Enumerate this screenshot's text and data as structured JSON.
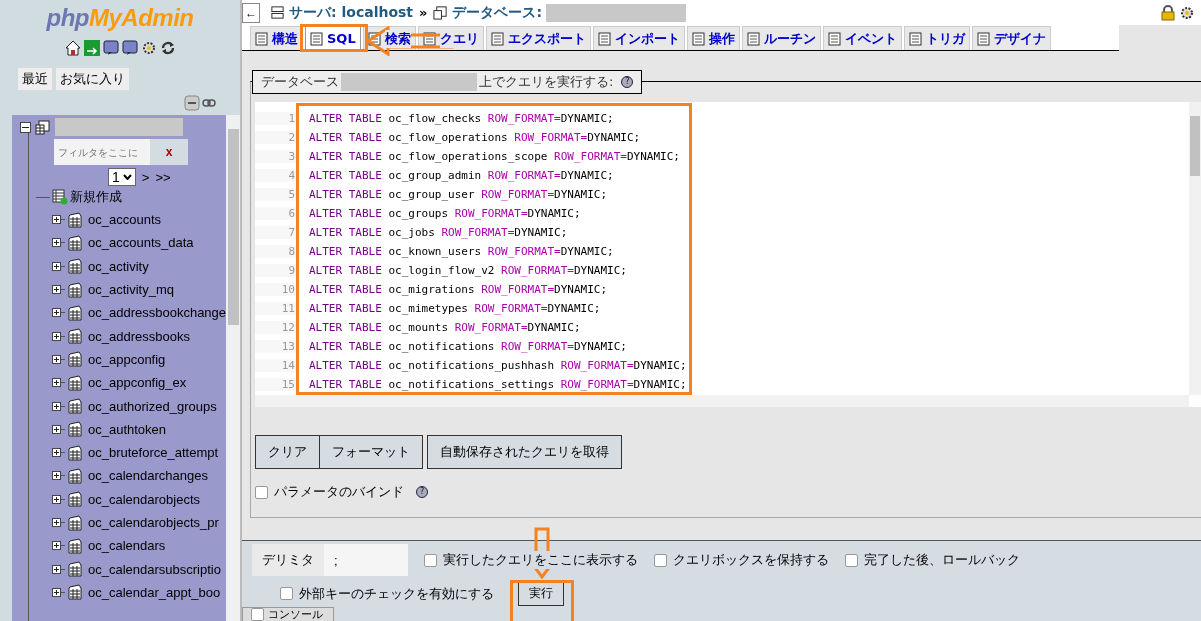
{
  "logo": {
    "first": "php",
    "second": "MyAdmin"
  },
  "nav_buttons": [
    {
      "label": "最近"
    },
    {
      "label": "お気に入り"
    }
  ],
  "tree": {
    "expanded": true,
    "filter": {
      "placeholder": "フィルタをここに",
      "clear": "x"
    },
    "page": "1",
    "next": ">",
    "last": ">>",
    "new_item": "新規作成",
    "items": [
      {
        "name": "oc_accounts",
        "expanded": false
      },
      {
        "name": "oc_accounts_data",
        "expanded": false
      },
      {
        "name": "oc_activity",
        "expanded": false
      },
      {
        "name": "oc_activity_mq",
        "expanded": false
      },
      {
        "name": "oc_addressbookchange",
        "expanded": false
      },
      {
        "name": "oc_addressbooks",
        "expanded": false
      },
      {
        "name": "oc_appconfig",
        "expanded": false
      },
      {
        "name": "oc_appconfig_ex",
        "expanded": false
      },
      {
        "name": "oc_authorized_groups",
        "expanded": false
      },
      {
        "name": "oc_authtoken",
        "expanded": false
      },
      {
        "name": "oc_bruteforce_attempt",
        "expanded": false
      },
      {
        "name": "oc_calendarchanges",
        "expanded": false
      },
      {
        "name": "oc_calendarobjects",
        "expanded": false
      },
      {
        "name": "oc_calendarobjects_pr",
        "expanded": false
      },
      {
        "name": "oc_calendars",
        "expanded": false
      },
      {
        "name": "oc_calendarsubscriptio",
        "expanded": false
      },
      {
        "name": "oc_calendar_appt_boo",
        "expanded": false
      }
    ]
  },
  "breadcrumb": {
    "back": "←",
    "server": "サーバ: localhost",
    "separator": "»",
    "database": "データベース:"
  },
  "tabs": [
    {
      "label": "構造",
      "selected": false
    },
    {
      "label": "SQL",
      "selected": true
    },
    {
      "label": "検索",
      "selected": false
    },
    {
      "label": "クエリ",
      "selected": false
    },
    {
      "label": "エクスポート",
      "selected": false
    },
    {
      "label": "インポート",
      "selected": false
    },
    {
      "label": "操作",
      "selected": false
    },
    {
      "label": "ルーチン",
      "selected": false
    },
    {
      "label": "イベント",
      "selected": false
    },
    {
      "label": "トリガ",
      "selected": false
    },
    {
      "label": "デザイナ",
      "selected": false
    }
  ],
  "legend": {
    "before": "データベース",
    "after": "上でクエリを実行する:",
    "help": "?"
  },
  "editor": {
    "lines": [
      {
        "number": "1",
        "keyword": "ALTER TABLE",
        "table": "oc_flow_checks",
        "option": "ROW_FORMAT=",
        "value": "DYNAMIC;"
      },
      {
        "number": "2",
        "keyword": "ALTER TABLE",
        "table": "oc_flow_operations",
        "option": "ROW_FORMAT=",
        "value": "DYNAMIC;"
      },
      {
        "number": "3",
        "keyword": "ALTER TABLE",
        "table": "oc_flow_operations_scope",
        "option": "ROW_FORMAT=",
        "value": "DYNAMIC;"
      },
      {
        "number": "4",
        "keyword": "ALTER TABLE",
        "table": "oc_group_admin",
        "option": "ROW_FORMAT=",
        "value": "DYNAMIC;"
      },
      {
        "number": "5",
        "keyword": "ALTER TABLE",
        "table": "oc_group_user",
        "option": "ROW_FORMAT=",
        "value": "DYNAMIC;"
      },
      {
        "number": "6",
        "keyword": "ALTER TABLE",
        "table": "oc_groups",
        "option": "ROW_FORMAT=",
        "value": "DYNAMIC;"
      },
      {
        "number": "7",
        "keyword": "ALTER TABLE",
        "table": "oc_jobs",
        "option": "ROW_FORMAT=",
        "value": "DYNAMIC;"
      },
      {
        "number": "8",
        "keyword": "ALTER TABLE",
        "table": "oc_known_users",
        "option": "ROW_FORMAT=",
        "value": "DYNAMIC;"
      },
      {
        "number": "9",
        "keyword": "ALTER TABLE",
        "table": "oc_login_flow_v2",
        "option": "ROW_FORMAT=",
        "value": "DYNAMIC;"
      },
      {
        "number": "10",
        "keyword": "ALTER TABLE",
        "table": "oc_migrations",
        "option": "ROW_FORMAT=",
        "value": "DYNAMIC;"
      },
      {
        "number": "11",
        "keyword": "ALTER TABLE",
        "table": "oc_mimetypes",
        "option": "ROW_FORMAT=",
        "value": "DYNAMIC;"
      },
      {
        "number": "12",
        "keyword": "ALTER TABLE",
        "table": "oc_mounts",
        "option": "ROW_FORMAT=",
        "value": "DYNAMIC;"
      },
      {
        "number": "13",
        "keyword": "ALTER TABLE",
        "table": "oc_notifications",
        "option": "ROW_FORMAT=",
        "value": "DYNAMIC;"
      },
      {
        "number": "14",
        "keyword": "ALTER TABLE",
        "table": "oc_notifications_pushhash",
        "option": "ROW_FORMAT=",
        "value": "DYNAMIC;"
      },
      {
        "number": "15",
        "keyword": "ALTER TABLE",
        "table": "oc_notifications_settings",
        "option": "ROW_FORMAT=",
        "value": "DYNAMIC;"
      }
    ]
  },
  "query_buttons": [
    {
      "label": "クリア"
    },
    {
      "label": "フォーマット"
    },
    {
      "label": "自動保存されたクエリを取得"
    }
  ],
  "bind_parameters": {
    "label": "パラメータのバインド",
    "checked": false,
    "help": "?"
  },
  "delimiter": {
    "label": "デリミタ",
    "value": ";"
  },
  "options": [
    {
      "label": "実行したクエリをここに表示する",
      "checked": false
    },
    {
      "label": "クエリボックスを保持する",
      "checked": false
    },
    {
      "label": "完了した後、ロールバック",
      "checked": false
    }
  ],
  "foreign_keys": {
    "label": "外部キーのチェックを有効にする",
    "checked": false
  },
  "go_button": "実行",
  "console": "コンソール"
}
